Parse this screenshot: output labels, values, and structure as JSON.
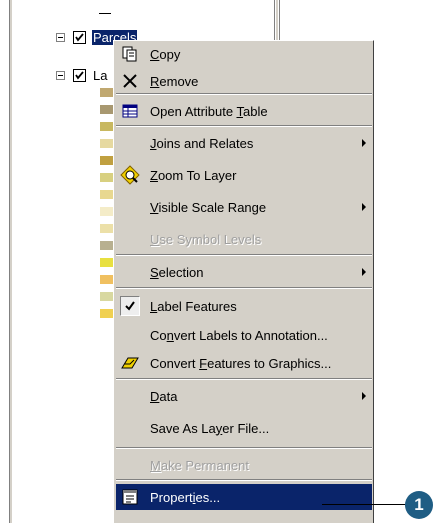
{
  "toc": {
    "layers": [
      {
        "name": "Parcels",
        "checked": true,
        "selected": true
      },
      {
        "name": "La",
        "checked": true,
        "selected": false
      }
    ],
    "swatch_colors": [
      "#c0a870",
      "#a89870",
      "#c8b860",
      "#e6d9a0",
      "#c0a040",
      "#d8d080",
      "#e8d890",
      "#f4ecc8",
      "#ece0a8",
      "#b8b090",
      "#e8e040",
      "#f0c060",
      "#d8d8a0",
      "#f0d050"
    ]
  },
  "menu": {
    "items": [
      {
        "id": "copy",
        "pre": "",
        "u": "C",
        "post": "opy",
        "icon": "copy-icon",
        "submenu": false,
        "disabled": false
      },
      {
        "id": "remove",
        "pre": "",
        "u": "R",
        "post": "emove",
        "icon": "remove-icon",
        "submenu": false,
        "disabled": false
      },
      {
        "id": "open-attribute-table",
        "pre": "Open Attribute ",
        "u": "T",
        "post": "able",
        "icon": "table-icon",
        "submenu": false,
        "disabled": false
      },
      {
        "id": "joins-and-relates",
        "pre": "",
        "u": "J",
        "post": "oins and Relates",
        "icon": "",
        "submenu": true,
        "disabled": false
      },
      {
        "id": "zoom-to-layer",
        "pre": "",
        "u": "Z",
        "post": "oom To Layer",
        "icon": "zoom-to-layer-icon",
        "submenu": false,
        "disabled": false
      },
      {
        "id": "visible-scale-range",
        "pre": "",
        "u": "V",
        "post": "isible Scale Range",
        "icon": "",
        "submenu": true,
        "disabled": false
      },
      {
        "id": "use-symbol-levels",
        "pre": "",
        "u": "U",
        "post": "se Symbol Levels",
        "icon": "",
        "submenu": false,
        "disabled": true
      },
      {
        "id": "selection",
        "pre": "",
        "u": "S",
        "post": "election",
        "icon": "",
        "submenu": true,
        "disabled": false
      },
      {
        "id": "label-features",
        "pre": "",
        "u": "L",
        "post": "abel Features",
        "icon": "checkmark-icon",
        "submenu": false,
        "disabled": false,
        "checked": true
      },
      {
        "id": "convert-labels",
        "pre": "Co",
        "u": "n",
        "post": "vert Labels to Annotation...",
        "icon": "",
        "submenu": false,
        "disabled": false
      },
      {
        "id": "convert-features",
        "pre": "Convert ",
        "u": "F",
        "post": "eatures to Graphics...",
        "icon": "convert-features-icon",
        "submenu": false,
        "disabled": false
      },
      {
        "id": "data",
        "pre": "",
        "u": "D",
        "post": "ata",
        "icon": "",
        "submenu": true,
        "disabled": false
      },
      {
        "id": "save-as-layer-file",
        "pre": "Save As La",
        "u": "y",
        "post": "er File...",
        "icon": "",
        "submenu": false,
        "disabled": false
      },
      {
        "id": "make-permanent",
        "pre": "",
        "u": "M",
        "post": "ake Permanent",
        "icon": "",
        "submenu": false,
        "disabled": true
      },
      {
        "id": "properties",
        "pre": "Propert",
        "u": "i",
        "post": "es...",
        "icon": "properties-icon",
        "submenu": false,
        "disabled": false,
        "highlight": true
      }
    ]
  },
  "callout": {
    "number": "1"
  }
}
